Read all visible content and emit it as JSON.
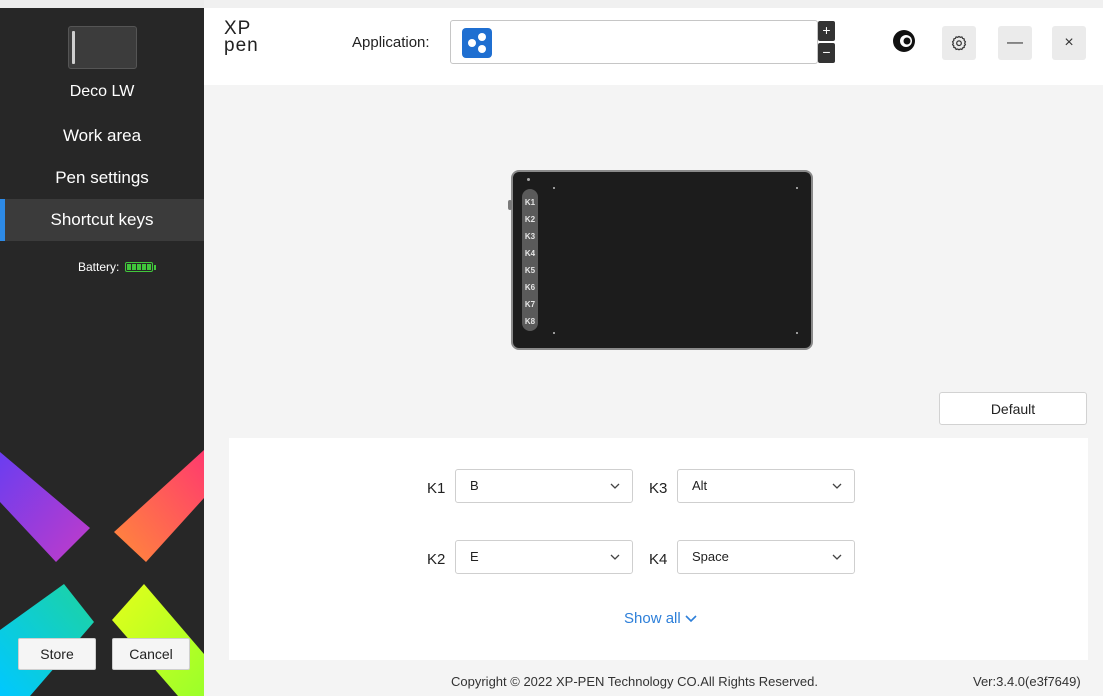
{
  "sidebar": {
    "device_name": "Deco LW",
    "items": [
      {
        "label": "Work area",
        "active": false
      },
      {
        "label": "Pen settings",
        "active": false
      },
      {
        "label": "Shortcut keys",
        "active": true
      }
    ],
    "battery_label": "Battery:",
    "store_label": "Store",
    "cancel_label": "Cancel"
  },
  "header": {
    "logo_line1": "XP",
    "logo_line2": "pen",
    "application_label": "Application:",
    "selected_app_icon": "all-apps-icon",
    "plus_label": "+",
    "minus_label": "−",
    "settings_icon": "gear-icon",
    "minimize_label": "—",
    "close_label": "×"
  },
  "tablet": {
    "keys": [
      "K1",
      "K2",
      "K3",
      "K4",
      "K5",
      "K6",
      "K7",
      "K8"
    ]
  },
  "main": {
    "default_label": "Default",
    "shortcuts": [
      {
        "key": "K1",
        "value": "B"
      },
      {
        "key": "K3",
        "value": "Alt"
      },
      {
        "key": "K2",
        "value": "E"
      },
      {
        "key": "K4",
        "value": "Space"
      }
    ],
    "show_all_label": "Show all"
  },
  "footer": {
    "copyright": "Copyright © 2022  XP-PEN Technology CO.All Rights Reserved.",
    "version": "Ver:3.4.0(e3f7649)"
  },
  "colors": {
    "accent": "#2d8ae6",
    "sidebar_bg": "#272727",
    "battery": "#41c83c",
    "link": "#2d7fd9"
  }
}
